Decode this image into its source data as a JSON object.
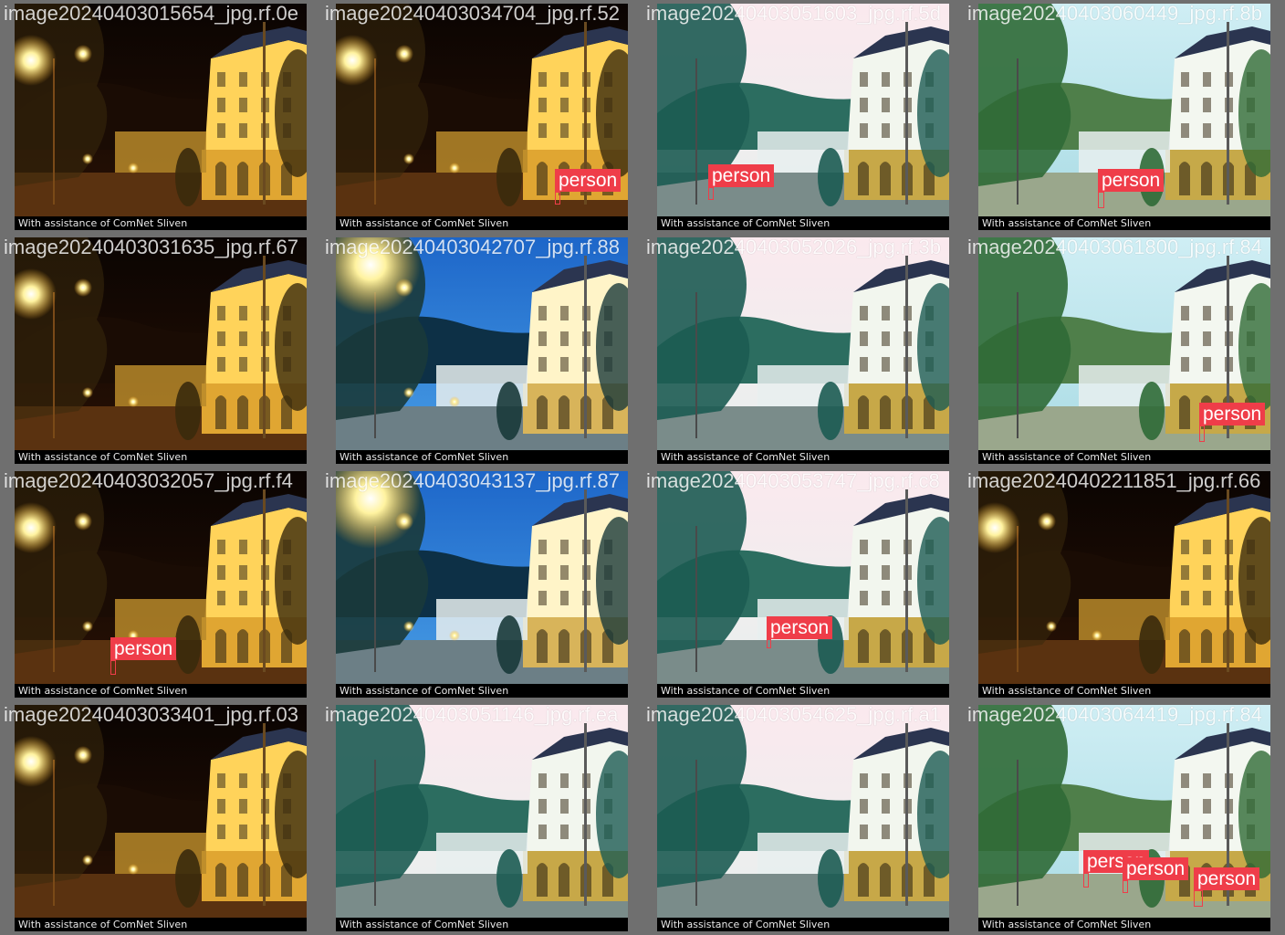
{
  "caption_text": "With assistance of ComNet Sliven",
  "label_color": "#ef3d49",
  "tiles": [
    {
      "filename": "image20240403015654_jpg.rf.0e",
      "scene": "night",
      "detections": []
    },
    {
      "filename": "image20240403034704_jpg.rf.52",
      "scene": "night",
      "detections": [
        {
          "label": "person"
        }
      ]
    },
    {
      "filename": "image20240403051603_jpg.rf.5d",
      "scene": "teal",
      "detections": [
        {
          "label": "person"
        }
      ]
    },
    {
      "filename": "image20240403060449_jpg.rf.8b",
      "scene": "day",
      "detections": [
        {
          "label": "person"
        }
      ]
    },
    {
      "filename": "image20240403031635_jpg.rf.67",
      "scene": "night",
      "detections": []
    },
    {
      "filename": "image20240403042707_jpg.rf.88",
      "scene": "dusk",
      "detections": []
    },
    {
      "filename": "image20240403052026_jpg.rf.3b",
      "scene": "teal",
      "detections": []
    },
    {
      "filename": "image20240403061800_jpg.rf.84",
      "scene": "day",
      "detections": [
        {
          "label": "person"
        }
      ]
    },
    {
      "filename": "image20240403032057_jpg.rf.f4",
      "scene": "night",
      "detections": [
        {
          "label": "person"
        }
      ]
    },
    {
      "filename": "image20240403043137_jpg.rf.87",
      "scene": "dusk",
      "detections": []
    },
    {
      "filename": "image20240403053747_jpg.rf.c8",
      "scene": "teal",
      "detections": [
        {
          "label": "person"
        }
      ]
    },
    {
      "filename": "image20240402211851_jpg.rf.66",
      "scene": "night",
      "detections": []
    },
    {
      "filename": "image20240403033401_jpg.rf.03",
      "scene": "night",
      "detections": []
    },
    {
      "filename": "image20240403051146_jpg.rf.ea",
      "scene": "teal",
      "detections": []
    },
    {
      "filename": "image20240403054625_jpg.rf.a1",
      "scene": "teal",
      "detections": []
    },
    {
      "filename": "image20240403064419_jpg.rf.84",
      "scene": "day",
      "detections": [
        {
          "label": "person"
        },
        {
          "label": "person"
        },
        {
          "label": "person"
        }
      ]
    }
  ]
}
